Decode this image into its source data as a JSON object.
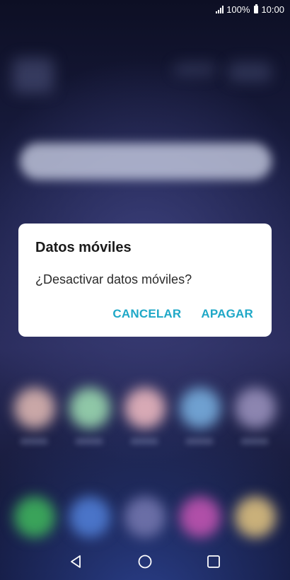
{
  "status_bar": {
    "battery": "100%",
    "time": "10:00",
    "icons": [
      "signal-icon",
      "battery-icon"
    ]
  },
  "dialog": {
    "title": "Datos móviles",
    "message": "¿Desactivar datos móviles?",
    "cancel_label": "CANCELAR",
    "confirm_label": "APAGAR",
    "accent_color": "#1fa8c7"
  },
  "nav_bar": {
    "icons": [
      "back-icon",
      "home-icon",
      "recents-icon"
    ]
  }
}
